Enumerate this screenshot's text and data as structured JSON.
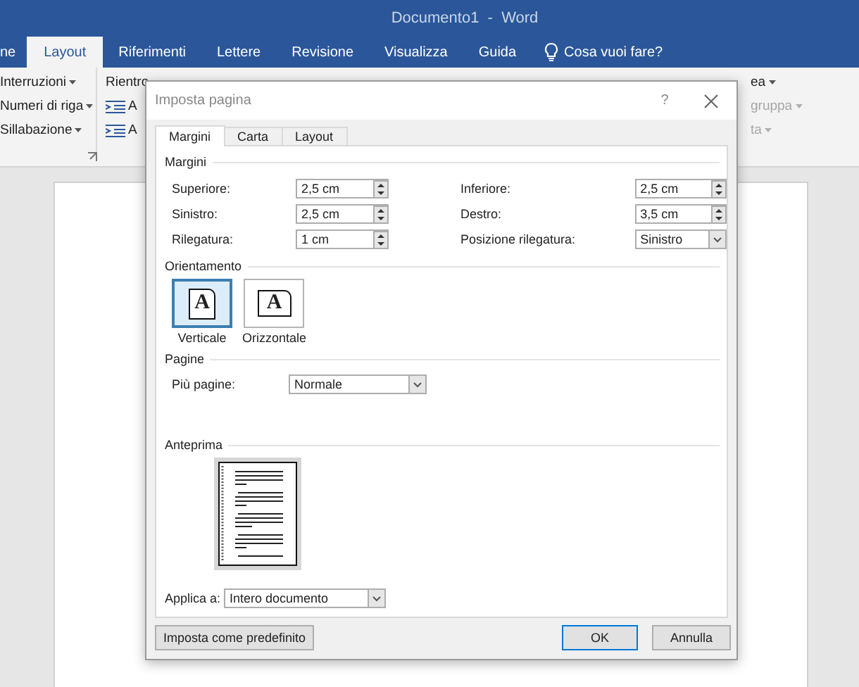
{
  "app": {
    "title": "Documento1  -  Word",
    "tabs": [
      {
        "label": "ne",
        "selected": false
      },
      {
        "label": "Layout",
        "selected": true
      },
      {
        "label": "Riferimenti",
        "selected": false
      },
      {
        "label": "Lettere",
        "selected": false
      },
      {
        "label": "Revisione",
        "selected": false
      },
      {
        "label": "Visualizza",
        "selected": false
      },
      {
        "label": "Guida",
        "selected": false
      }
    ],
    "tell_me": "Cosa vuoi fare?"
  },
  "ribbon": {
    "page_setup_items": [
      "Interruzioni",
      "Numeri di riga",
      "Sillabazione"
    ],
    "indent": {
      "title": "Rientro",
      "items": [
        "A",
        "A"
      ]
    },
    "arrange_items": [
      {
        "label": "ea",
        "disabled": false
      },
      {
        "label": "gruppa",
        "disabled": true
      },
      {
        "label": "ta",
        "disabled": true
      }
    ]
  },
  "dialog": {
    "title": "Imposta pagina",
    "help": "?",
    "tabs": [
      {
        "label": "Margini",
        "selected": true
      },
      {
        "label": "Carta",
        "selected": false
      },
      {
        "label": "Layout",
        "selected": false
      }
    ],
    "margins": {
      "heading": "Margini",
      "fields": [
        {
          "label": "Superiore:",
          "value": "2,5 cm",
          "kind": "spin"
        },
        {
          "label": "Inferiore:",
          "value": "2,5 cm",
          "kind": "spin"
        },
        {
          "label": "Sinistro:",
          "value": "2,5 cm",
          "kind": "spin"
        },
        {
          "label": "Destro:",
          "value": "3,5 cm",
          "kind": "spin"
        },
        {
          "label": "Rilegatura:",
          "value": "1 cm",
          "kind": "spin"
        },
        {
          "label": "Posizione rilegatura:",
          "value": "Sinistro",
          "kind": "dropdown"
        }
      ]
    },
    "orientation": {
      "heading": "Orientamento",
      "options": [
        {
          "label": "Verticale",
          "glyph": "A",
          "selected": true
        },
        {
          "label": "Orizzontale",
          "glyph": "A",
          "selected": false
        }
      ]
    },
    "pages": {
      "heading": "Pagine",
      "label": "Più pagine:",
      "value": "Normale"
    },
    "preview": {
      "heading": "Anteprima"
    },
    "apply_to": {
      "label": "Applica a:",
      "value": "Intero documento"
    },
    "buttons": [
      {
        "label": "Imposta come predefinito",
        "kind": "secondary"
      },
      {
        "label": "OK",
        "kind": "default"
      },
      {
        "label": "Annulla",
        "kind": "normal"
      }
    ]
  }
}
